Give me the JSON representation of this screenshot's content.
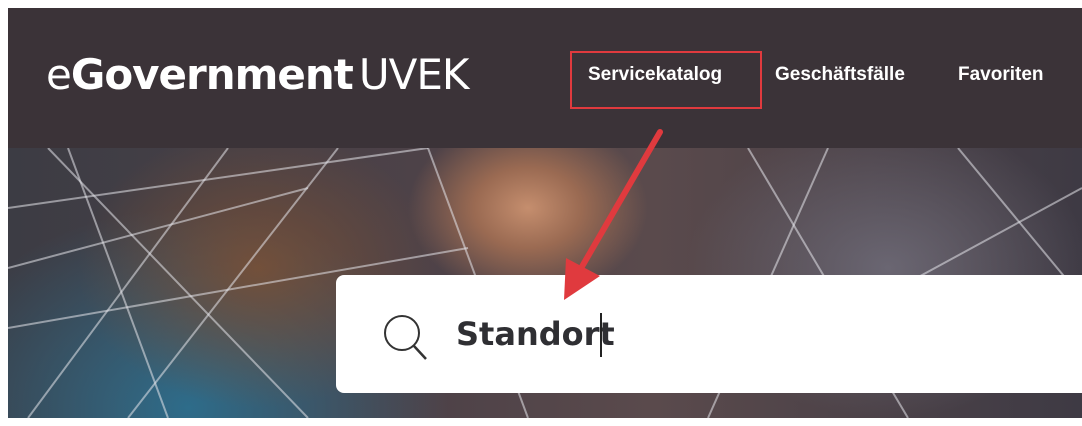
{
  "header": {
    "logo": {
      "prefix": "e",
      "bold": "Government",
      "light": "UVEK"
    },
    "nav": [
      {
        "label": "Servicekatalog",
        "highlighted": true
      },
      {
        "label": "Geschäftsfälle"
      },
      {
        "label": "Favoriten"
      }
    ]
  },
  "search": {
    "value": "Standort",
    "icon": "search-icon"
  },
  "annotation": {
    "color": "#e03a3e"
  },
  "colors": {
    "header_bg": "#3b3338",
    "text": "#ffffff"
  }
}
